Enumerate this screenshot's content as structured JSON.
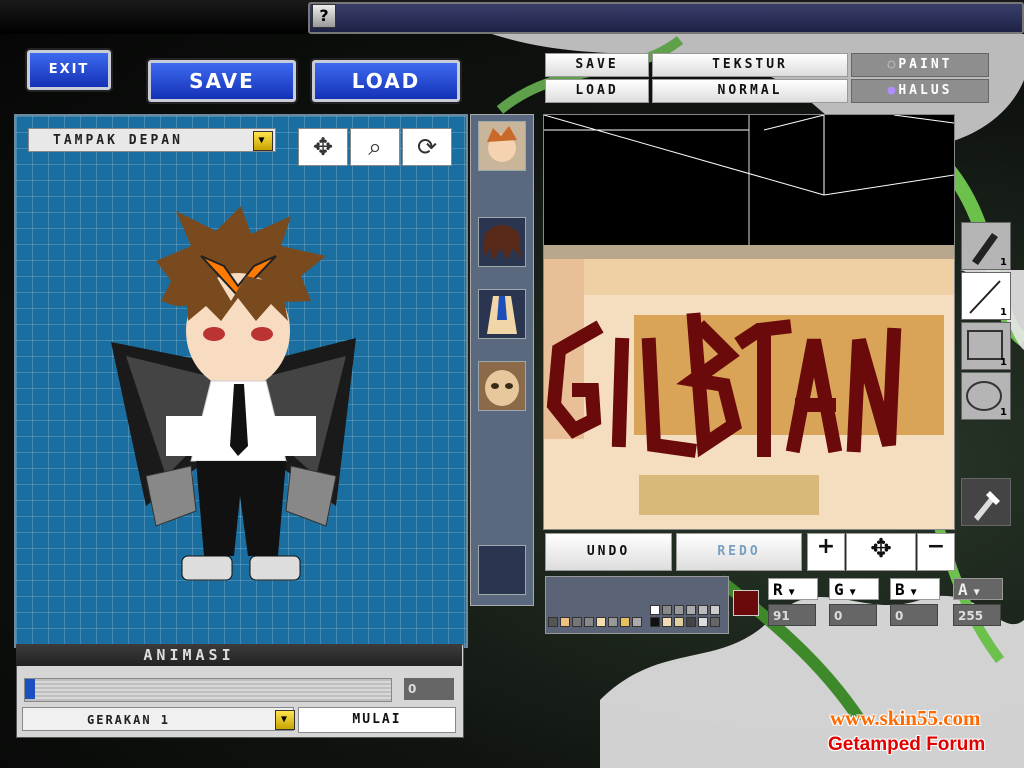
{
  "topbar": {
    "help_label": "?"
  },
  "left_toolbar": {
    "exit_label": "EXIT",
    "save_label": "SAVE",
    "load_label": "LOAD"
  },
  "preview": {
    "view_select_value": "TAMPAK DEPAN",
    "tools": [
      "move-icon",
      "zoom-icon",
      "rotate-icon"
    ]
  },
  "animation": {
    "title": "ANIMASI",
    "frame_value": "0",
    "slider_fraction": 0,
    "motion_select_value": "GERAKAN 1",
    "start_label": "MULAI"
  },
  "texture_menu": {
    "save_label": "SAVE",
    "load_label": "LOAD",
    "texture_label": "TEKSTUR",
    "normal_label": "NORMAL",
    "paint_label": "PAINT",
    "smooth_label": "HALUS",
    "selected_mode": "HALUS"
  },
  "canvas": {
    "painted_text": "GILBTAN",
    "paint_color": "#6b0a0a"
  },
  "draw_tools": [
    {
      "icon": "brush-icon",
      "size": "1"
    },
    {
      "icon": "line-icon",
      "size": "1"
    },
    {
      "icon": "rectangle-icon",
      "size": "1"
    },
    {
      "icon": "ellipse-icon",
      "size": "1"
    },
    {
      "icon": "eyedropper-icon",
      "size": ""
    }
  ],
  "edit_row": {
    "undo_label": "UNDO",
    "redo_label": "REDO",
    "zoom_in": "+",
    "zoom_out": "−"
  },
  "color": {
    "current": "#6b0a0a",
    "r_label": "R",
    "g_label": "G",
    "b_label": "B",
    "a_label": "A",
    "r": "91",
    "g": "0",
    "b": "0",
    "a": "255"
  },
  "watermark": {
    "site": "www.skin55.com",
    "forum": "Getamped Forum"
  }
}
